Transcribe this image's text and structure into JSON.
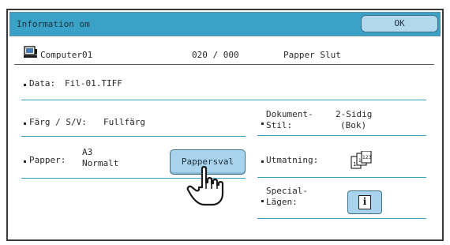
{
  "window": {
    "title": "Information om",
    "ok_label": "OK"
  },
  "status": {
    "computer_name": "Computer01",
    "count": "020 / 000",
    "message": "Papper Slut"
  },
  "data_row": {
    "label": "Data:",
    "value": "Fil-01.TIFF"
  },
  "color_row": {
    "label": "Färg / S/V:",
    "value": "Fullfärg"
  },
  "document_style": {
    "label_line1": "Dokument-",
    "label_line2": "Stil:",
    "value_line1": "2-Sidig",
    "value_line2": "(Bok)"
  },
  "paper": {
    "label": "Papper:",
    "size": "A3",
    "type": "Normalt",
    "button_label": "Pappersval"
  },
  "output": {
    "label": "Utmatning:"
  },
  "special_modes": {
    "label_line1": "Special-",
    "label_line2": "Lägen:",
    "button_glyph": "i"
  },
  "icons": {
    "computer": "computer-icon",
    "output": "output-sort-icon",
    "info": "info-icon",
    "pointer": "hand-pointer-icon"
  },
  "colors": {
    "titlebar": "#3aa2c7",
    "button": "#a9d3ec",
    "divider": "#3aa0c4"
  }
}
